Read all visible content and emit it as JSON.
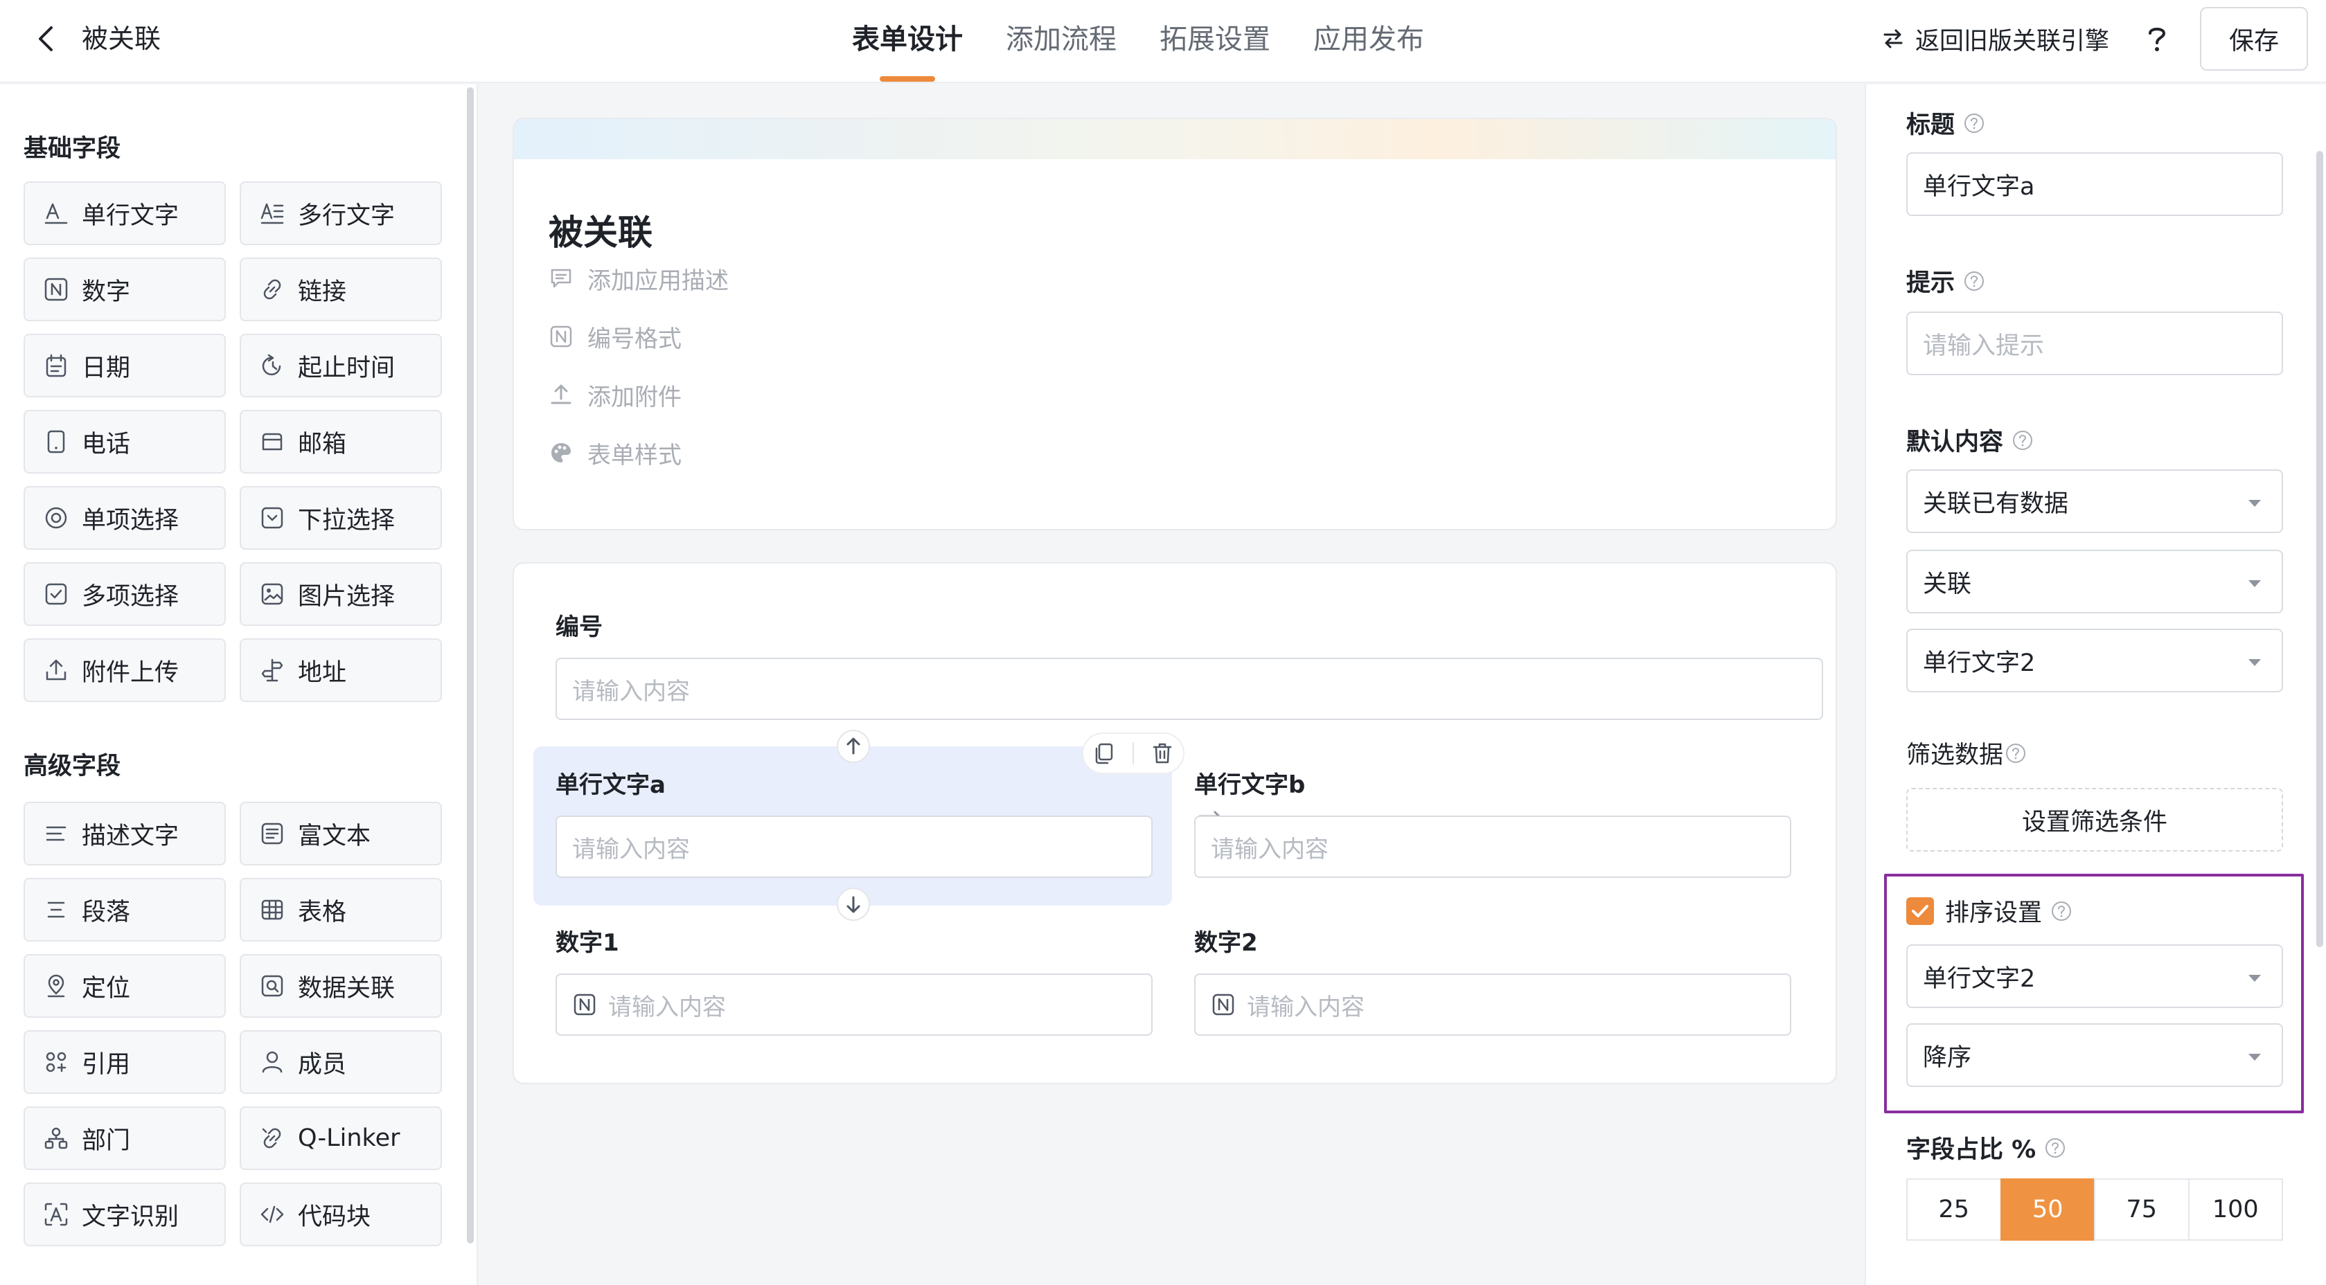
{
  "header": {
    "back_icon": "chevron-left-icon",
    "title": "被关联",
    "tabs": [
      {
        "label": "表单设计",
        "active": true
      },
      {
        "label": "添加流程",
        "active": false
      },
      {
        "label": "拓展设置",
        "active": false
      },
      {
        "label": "应用发布",
        "active": false
      }
    ],
    "legacy_link": "返回旧版关联引擎",
    "help": "?",
    "save_label": "保存"
  },
  "sidebar": {
    "basic_title": "基础字段",
    "basic_fields": [
      {
        "label": "单行文字",
        "icon": "text-a-icon"
      },
      {
        "label": "多行文字",
        "icon": "multiline-text-icon"
      },
      {
        "label": "数字",
        "icon": "number-icon"
      },
      {
        "label": "链接",
        "icon": "link-icon"
      },
      {
        "label": "日期",
        "icon": "calendar-icon"
      },
      {
        "label": "起止时间",
        "icon": "time-range-icon"
      },
      {
        "label": "电话",
        "icon": "phone-icon"
      },
      {
        "label": "邮箱",
        "icon": "mail-icon"
      },
      {
        "label": "单项选择",
        "icon": "radio-icon"
      },
      {
        "label": "下拉选择",
        "icon": "dropdown-icon"
      },
      {
        "label": "多项选择",
        "icon": "checkbox-icon"
      },
      {
        "label": "图片选择",
        "icon": "image-icon"
      },
      {
        "label": "附件上传",
        "icon": "upload-icon"
      },
      {
        "label": "地址",
        "icon": "signpost-icon"
      }
    ],
    "advanced_title": "高级字段",
    "advanced_fields": [
      {
        "label": "描述文字",
        "icon": "description-icon"
      },
      {
        "label": "富文本",
        "icon": "rich-text-icon"
      },
      {
        "label": "段落",
        "icon": "paragraph-icon"
      },
      {
        "label": "表格",
        "icon": "table-icon"
      },
      {
        "label": "定位",
        "icon": "location-icon"
      },
      {
        "label": "数据关联",
        "icon": "data-link-icon"
      },
      {
        "label": "引用",
        "icon": "reference-icon"
      },
      {
        "label": "成员",
        "icon": "member-icon"
      },
      {
        "label": "部门",
        "icon": "department-icon"
      },
      {
        "label": "Q-Linker",
        "icon": "q-linker-icon"
      },
      {
        "label": "文字识别",
        "icon": "ocr-icon"
      },
      {
        "label": "代码块",
        "icon": "code-icon"
      }
    ]
  },
  "canvas": {
    "form_title": "被关联",
    "meta_items": [
      {
        "label": "添加应用描述",
        "icon": "comment-icon"
      },
      {
        "label": "编号格式",
        "icon": "number-format-icon"
      },
      {
        "label": "添加附件",
        "icon": "upload-icon"
      },
      {
        "label": "表单样式",
        "icon": "palette-icon"
      }
    ],
    "fields": {
      "serial": {
        "label": "编号",
        "placeholder": "请输入内容"
      },
      "text_a": {
        "label": "单行文字a",
        "placeholder": "请输入内容"
      },
      "text_b": {
        "label": "单行文字b",
        "placeholder": "请输入内容"
      },
      "num1": {
        "label": "数字1",
        "placeholder": "请输入内容"
      },
      "num2": {
        "label": "数字2",
        "placeholder": "请输入内容"
      }
    }
  },
  "props": {
    "title_label": "标题",
    "title_value": "单行文字a",
    "hint_label": "提示",
    "hint_placeholder": "请输入提示",
    "default_label": "默认内容",
    "default_selects": [
      "关联已有数据",
      "关联",
      "单行文字2"
    ],
    "filter_label": "筛选数据",
    "filter_button": "设置筛选条件",
    "sort_label": "排序设置",
    "sort_checked": true,
    "sort_field": "单行文字2",
    "sort_order": "降序",
    "ratio_label": "字段占比 %",
    "ratio_options": [
      "25",
      "50",
      "75",
      "100"
    ],
    "ratio_selected": "50"
  },
  "colors": {
    "accent": "#ee8a3c",
    "selected_field_bg": "#e9eefc",
    "highlight_border": "#8a2d9e"
  }
}
